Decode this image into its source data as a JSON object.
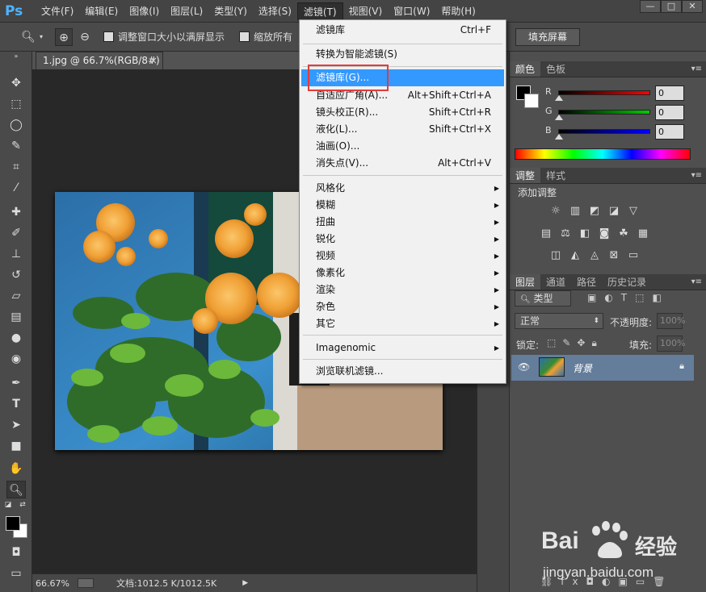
{
  "menubar": {
    "logo": "Ps",
    "items": [
      "文件(F)",
      "编辑(E)",
      "图像(I)",
      "图层(L)",
      "类型(Y)",
      "选择(S)",
      "滤镜(T)",
      "视图(V)",
      "窗口(W)",
      "帮助(H)"
    ],
    "window_controls": [
      "—",
      "□",
      "✕"
    ]
  },
  "options": {
    "resize_label": "调整窗口大小以满屏显示",
    "zoom_all_label": "缩放所有",
    "fill_screen_label": "填充屏幕"
  },
  "document": {
    "tab_title": "1.jpg @ 66.7%(RGB/8#)",
    "tab_close": "×",
    "zoom": "66.67%",
    "doc_info": "文档:1012.5 K/1012.5K"
  },
  "filter_menu": {
    "items": [
      {
        "label": "滤镜库",
        "shortcut": "Ctrl+F"
      },
      {
        "label": "转换为智能滤镜(S)",
        "shortcut": ""
      },
      {
        "label": "滤镜库(G)...",
        "shortcut": ""
      },
      {
        "label": "自适应广角(A)...",
        "shortcut": "Alt+Shift+Ctrl+A"
      },
      {
        "label": "镜头校正(R)...",
        "shortcut": "Shift+Ctrl+R"
      },
      {
        "label": "液化(L)...",
        "shortcut": "Shift+Ctrl+X"
      },
      {
        "label": "油画(O)...",
        "shortcut": ""
      },
      {
        "label": "消失点(V)...",
        "shortcut": "Alt+Ctrl+V"
      },
      {
        "label": "风格化",
        "shortcut": ""
      },
      {
        "label": "模糊",
        "shortcut": ""
      },
      {
        "label": "扭曲",
        "shortcut": ""
      },
      {
        "label": "锐化",
        "shortcut": ""
      },
      {
        "label": "视频",
        "shortcut": ""
      },
      {
        "label": "像素化",
        "shortcut": ""
      },
      {
        "label": "渲染",
        "shortcut": ""
      },
      {
        "label": "杂色",
        "shortcut": ""
      },
      {
        "label": "其它",
        "shortcut": ""
      },
      {
        "label": "Imagenomic",
        "shortcut": ""
      },
      {
        "label": "浏览联机滤镜...",
        "shortcut": ""
      }
    ]
  },
  "color_panel": {
    "tabs": [
      "颜色",
      "色板"
    ],
    "channels": [
      {
        "label": "R",
        "value": "0",
        "color": "#ff0000"
      },
      {
        "label": "G",
        "value": "0",
        "color": "#00cc00"
      },
      {
        "label": "B",
        "value": "0",
        "color": "#0000ff"
      }
    ]
  },
  "adjust_panel": {
    "tabs": [
      "调整",
      "样式"
    ],
    "title": "添加调整"
  },
  "layers_panel": {
    "tabs": [
      "图层",
      "通道",
      "路径",
      "历史记录"
    ],
    "filter": "类型",
    "blend_mode": "正常",
    "opacity_label": "不透明度:",
    "opacity_value": "100%",
    "lock_label": "锁定:",
    "fill_label": "填充:",
    "fill_value": "100%",
    "layer_name": "背景"
  },
  "watermark": {
    "brand": "Bai",
    "brand2": "经验",
    "url": "jingyan.baidu.com"
  },
  "colors": {
    "menu_highlight": "#3399ff",
    "red_box": "#e23b3b",
    "layer_selected": "#647d9b"
  }
}
